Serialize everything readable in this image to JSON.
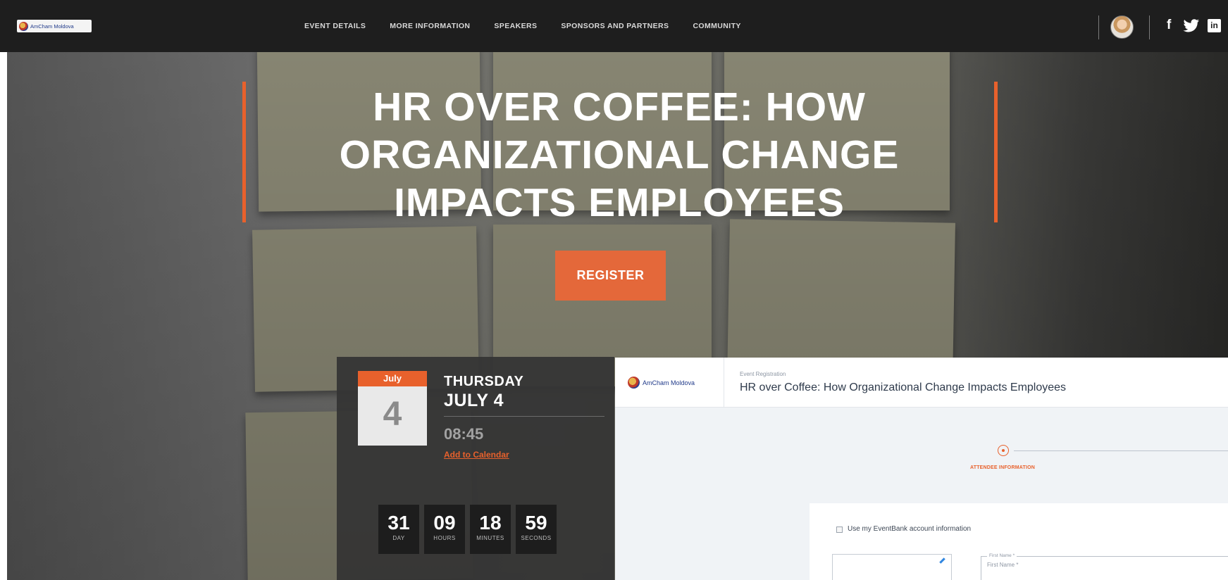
{
  "topbar": {
    "logo_text": "AmCham Moldova",
    "nav": [
      "EVENT DETAILS",
      "MORE INFORMATION",
      "SPEAKERS",
      "SPONSORS AND PARTNERS",
      "COMMUNITY"
    ],
    "social": {
      "facebook": "f",
      "linkedin": "in"
    }
  },
  "hero": {
    "title": "HR OVER COFFEE: HOW ORGANIZATIONAL CHANGE IMPACTS EMPLOYEES",
    "register_label": "REGISTER",
    "accent_color": "#e8612c"
  },
  "date_panel": {
    "month": "July",
    "day": "4",
    "weekday": "THURSDAY",
    "date": "JULY 4",
    "time": "08:45",
    "add_to_calendar": "Add to Calendar",
    "countdown": [
      {
        "value": "31",
        "unit": "DAY"
      },
      {
        "value": "09",
        "unit": "HOURS"
      },
      {
        "value": "18",
        "unit": "MINUTES"
      },
      {
        "value": "59",
        "unit": "SECONDS"
      }
    ]
  },
  "form": {
    "logo_text": "AmCham Moldova",
    "subtitle": "Event Registration",
    "title": "HR over Coffee: How Organizational Change Impacts Employees",
    "step_label": "ATTENDEE INFORMATION",
    "checkbox_label": "Use my EventBank account information",
    "first_name_label": "First Name *",
    "first_name_placeholder": "First Name *"
  }
}
